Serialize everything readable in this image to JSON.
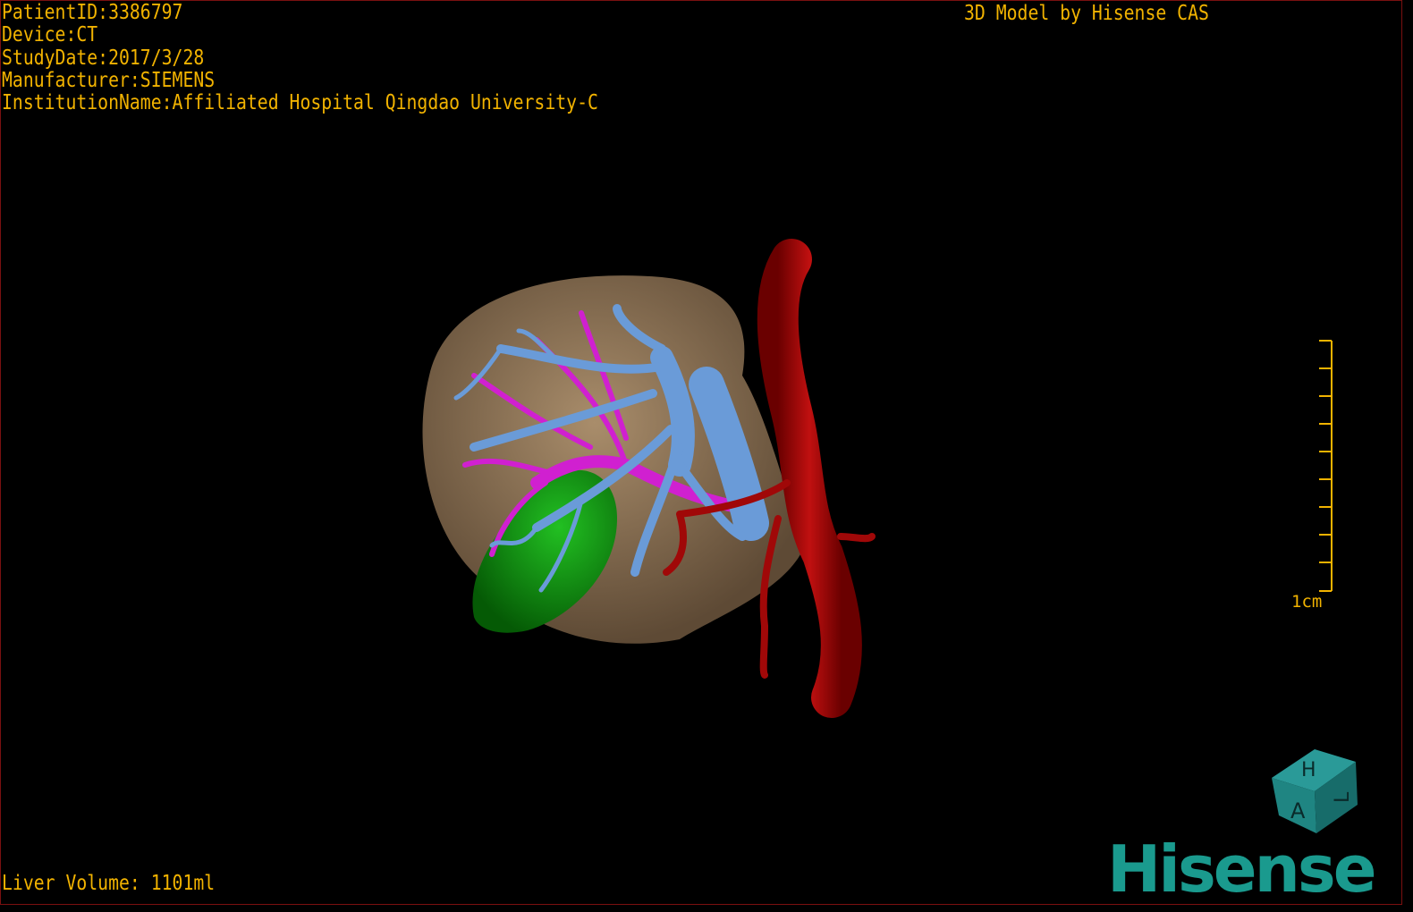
{
  "header": {
    "patient_id": "PatientID:3386797",
    "device": "Device:CT",
    "study_date": "StudyDate:2017/3/28",
    "manufacturer": "Manufacturer:SIEMENS",
    "institution": "InstitutionName:Affiliated Hospital Qingdao University-C",
    "title": "3D Model by Hisense CAS"
  },
  "footer": {
    "liver_volume": "Liver Volume: 1101ml"
  },
  "scale_bar": {
    "label": "1cm"
  },
  "orientation_cube": {
    "faces": [
      "H",
      "A",
      "L"
    ]
  },
  "logo": {
    "text": "Hisense"
  },
  "colors": {
    "text": "#f2b300",
    "liver": "#9b7f5f",
    "hepatic_vein": "#6a9bd8",
    "portal_vein": "#d020d0",
    "artery": "#a00808",
    "gallbladder": "#11a011",
    "brand": "#1a9a8e"
  }
}
